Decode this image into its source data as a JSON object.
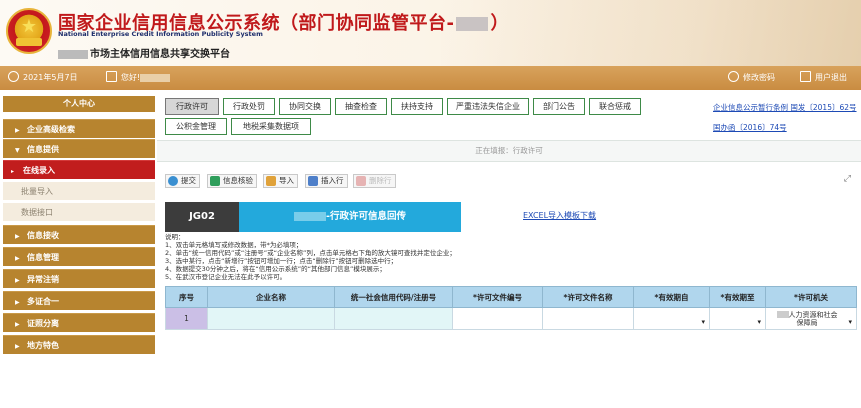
{
  "header": {
    "title_prefix": "国家企业信用信息公示系统（部门协同监管平台-",
    "title_suffix": "）",
    "title_en_line1": "National Enterprise Credit Information Publicity System",
    "subtitle": "市场主体信用信息共享交换平台"
  },
  "topbar": {
    "date": "2021年5月7日",
    "greeting": "您好!",
    "change_password": "修改密码",
    "logout": "用户退出"
  },
  "sidebar": {
    "personal_center": "个人中心",
    "items": [
      {
        "label": "企业高级检索",
        "arrow": "▶"
      },
      {
        "label": "信息提供",
        "arrow": "▼"
      },
      {
        "label": "在线录入",
        "arrow": "▸"
      },
      {
        "label": "批量导入"
      },
      {
        "label": "数据接口"
      },
      {
        "label": "信息接收",
        "arrow": "▶"
      },
      {
        "label": "信息管理",
        "arrow": "▶"
      },
      {
        "label": "异常注销",
        "arrow": "▶"
      },
      {
        "label": "多证合一",
        "arrow": "▶"
      },
      {
        "label": "证照分离",
        "arrow": "▶"
      },
      {
        "label": "地方特色",
        "arrow": "▶"
      }
    ]
  },
  "tabs": [
    "行政许可",
    "行政处罚",
    "协同交换",
    "抽查检查",
    "扶持支持",
    "严重违法失信企业",
    "部门公告",
    "联合惩戒",
    "公积金管理",
    "地税采集数据项"
  ],
  "links": {
    "regulation": "企业信息公示暂行条例 国发〔2015〕62号",
    "doc": "国办函〔2016〕74号"
  },
  "status": "正在填报：行政许可",
  "toolbar": {
    "submit": "提交",
    "verify": "信息核验",
    "import": "导入",
    "insert_row": "插入行",
    "delete_row": "删除行",
    "expand": "⤢"
  },
  "banner": {
    "code": "JG02",
    "name": "-行政许可信息回传",
    "excel_link": "EXCEL导入模板下载"
  },
  "notes": [
    "说明：",
    "1、双击单元格填写或修改数据，带*为必填项；",
    "2、单击“统一信用代码”或“注册号”或“企业名称”列，点击单元格右下角的放大镜可查找并定位企业；",
    "3、选中某行，点击“新增行”按钮可增加一行；点击“删除行”按钮可删除选中行；",
    "4、数据提交30分钟之后，将在“信用公示系统”的“其他部门信息”模块展示；",
    "5、在武汉市登记企业无法在此予以许可。"
  ],
  "table": {
    "headers": [
      "序号",
      "企业名称",
      "统一社会信用代码/注册号",
      "*许可文件编号",
      "*许可文件名称",
      "*有效期自",
      "*有效期至",
      "*许可机关"
    ],
    "rows": [
      {
        "seq": "1",
        "org_line1": "人力资源和社会",
        "org_line2": "保障局"
      }
    ],
    "dropdown_icon": "▾"
  }
}
